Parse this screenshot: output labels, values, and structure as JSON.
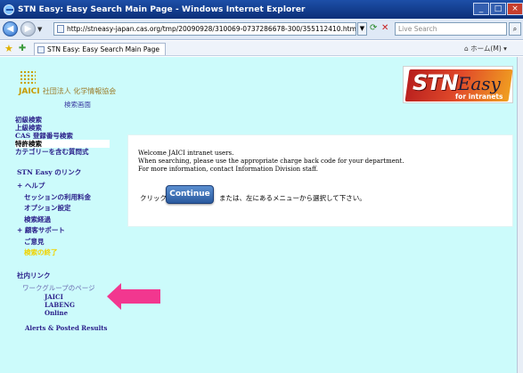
{
  "window": {
    "title": "STN Easy: Easy Search Main Page - Windows Internet Explorer",
    "controls": [
      "_",
      "□",
      "×"
    ]
  },
  "address_bar": {
    "url": "http://stneasy-japan.cas.org/tmp/20090928/310069-0737286678-300/355112410.html",
    "search_placeholder": "Live Search"
  },
  "favorites_bar": {
    "tab_title": "STN Easy: Easy Search Main Page",
    "home_label": "ホーム(M)"
  },
  "header": {
    "org_name_1": "JAICI",
    "org_name_2": "社団法人 化学情報協会",
    "screen_label": "検索画面"
  },
  "menu": {
    "items": [
      "初級検索",
      "上級検索",
      "CAS 登録番号検索",
      "特許検索",
      "カテゴリーを含む質問式"
    ],
    "active_index": 3
  },
  "stn_links": {
    "header": "STN Easy のリンク",
    "items": [
      {
        "label": "+ ヘルプ",
        "indent": false,
        "color": "normal"
      },
      {
        "label": "セッションの利用料金",
        "indent": true,
        "color": "normal"
      },
      {
        "label": "オプション設定",
        "indent": true,
        "color": "normal"
      },
      {
        "label": "検索経過",
        "indent": true,
        "color": "normal"
      },
      {
        "label": "+ 顧客サポート",
        "indent": false,
        "color": "normal"
      },
      {
        "label": "ご意見",
        "indent": true,
        "color": "normal"
      },
      {
        "label": "検索の終了",
        "indent": true,
        "color": "yellow"
      }
    ]
  },
  "intranet": {
    "header": "社内リンク",
    "workgroup": "ワークグループのページ",
    "sub_items": [
      "JAICI",
      "LABENG",
      "Online"
    ],
    "alerts": "Alerts & Posted Results"
  },
  "logo": {
    "stn": "STN",
    "easy": "Easy",
    "tagline": "for intranets"
  },
  "welcome": {
    "line1": "Welcome JAICI intranet users.",
    "line2": "When searching, please use the appropriate charge back code for your department.",
    "line3": "For more information, contact Information Division staff.",
    "click_prefix": "クリック",
    "continue_label": "Continue",
    "click_suffix": "または、左にあるメニューから選択して下さい。"
  },
  "colors": {
    "page_bg": "#ccfbfb",
    "menu_text": "#2a1f8a",
    "arrow": "#f2378f",
    "continue_bg": "#2a5a9e"
  }
}
